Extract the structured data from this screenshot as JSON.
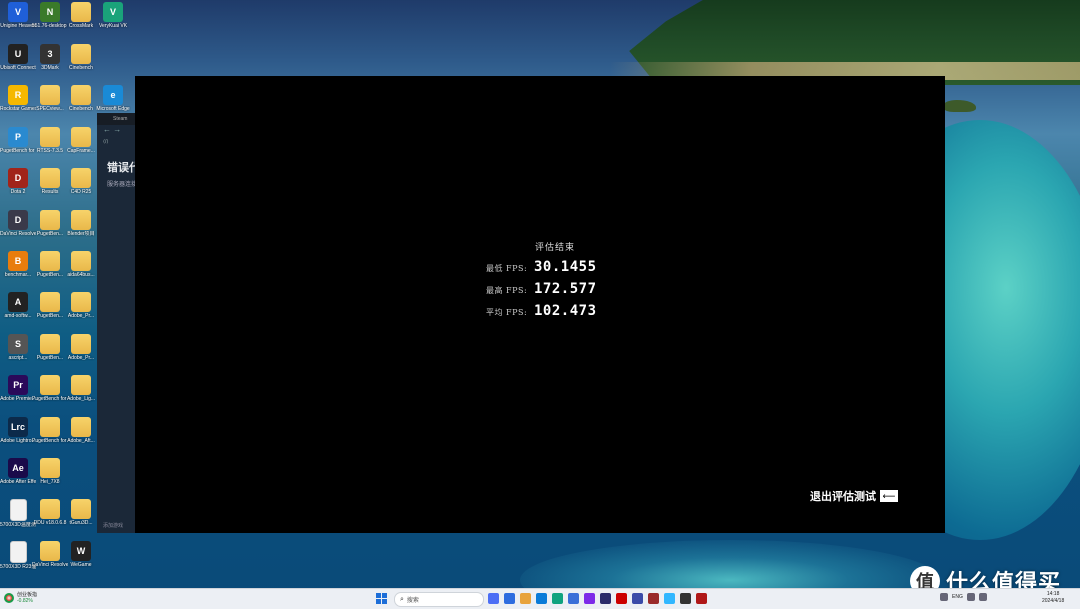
{
  "desktop_icons": [
    {
      "label": "Unigine Heaven",
      "color": "#1f5fd8",
      "glyph": "V",
      "kind": "app"
    },
    {
      "label": "551.76-desktop (1)",
      "color": "#3a7a2a",
      "glyph": "N",
      "kind": "app"
    },
    {
      "label": "CrossMark",
      "color": "",
      "glyph": "",
      "kind": "folder"
    },
    {
      "label": "VeryKuai VK",
      "color": "#1aa37a",
      "glyph": "V",
      "kind": "app"
    },
    {
      "label": "Ubisoft Connect",
      "color": "#222",
      "glyph": "U",
      "kind": "app"
    },
    {
      "label": "3DMark",
      "color": "#333",
      "glyph": "3",
      "kind": "app"
    },
    {
      "label": "Cinebench",
      "color": "",
      "glyph": "",
      "kind": "folder"
    },
    {
      "label": "Rockstar Games...",
      "color": "#f5b800",
      "glyph": "R",
      "kind": "app"
    },
    {
      "label": "SPECview...",
      "color": "",
      "glyph": "",
      "kind": "folder"
    },
    {
      "label": "Cinebench",
      "color": "",
      "glyph": "",
      "kind": "folder"
    },
    {
      "label": "Microsoft Edge",
      "color": "#1a8ad6",
      "glyph": "e",
      "kind": "app"
    },
    {
      "label": "PugetBench for Creat...",
      "color": "#2a8ad0",
      "glyph": "P",
      "kind": "app"
    },
    {
      "label": "RTSS-7.3.5",
      "color": "",
      "glyph": "",
      "kind": "folder"
    },
    {
      "label": "CapFrame...",
      "color": "",
      "glyph": "",
      "kind": "folder"
    },
    {
      "label": "Dota 2",
      "color": "#a1241a",
      "glyph": "D",
      "kind": "app"
    },
    {
      "label": "Results",
      "color": "",
      "glyph": "",
      "kind": "folder"
    },
    {
      "label": "C4D R25",
      "color": "",
      "glyph": "",
      "kind": "folder"
    },
    {
      "label": "DaVinci Resolve",
      "color": "#3a3a4a",
      "glyph": "D",
      "kind": "app"
    },
    {
      "label": "PugetBen...",
      "color": "",
      "glyph": "",
      "kind": "folder"
    },
    {
      "label": "Blender项目",
      "color": "",
      "glyph": "",
      "kind": "folder"
    },
    {
      "label": "benchmar...",
      "color": "#e87d0d",
      "glyph": "B",
      "kind": "app"
    },
    {
      "label": "PugetBen...",
      "color": "",
      "glyph": "",
      "kind": "folder"
    },
    {
      "label": "aida64bus...",
      "color": "",
      "glyph": "",
      "kind": "folder"
    },
    {
      "label": "amd-softw...",
      "color": "#222",
      "glyph": "A",
      "kind": "app"
    },
    {
      "label": "PugetBen...",
      "color": "",
      "glyph": "",
      "kind": "folder"
    },
    {
      "label": "Adobe_Pr...",
      "color": "",
      "glyph": "",
      "kind": "folder"
    },
    {
      "label": "ascript...",
      "color": "#555",
      "glyph": "S",
      "kind": "app"
    },
    {
      "label": "PugetBen...",
      "color": "",
      "glyph": "",
      "kind": "folder"
    },
    {
      "label": "Adobe_Pr...",
      "color": "",
      "glyph": "",
      "kind": "folder"
    },
    {
      "label": "Adobe Premie...",
      "color": "#2a0a5a",
      "glyph": "Pr",
      "kind": "app"
    },
    {
      "label": "PugetBench for Premi...",
      "color": "",
      "glyph": "",
      "kind": "folder"
    },
    {
      "label": "Adobe_Lig...",
      "color": "",
      "glyph": "",
      "kind": "folder"
    },
    {
      "label": "Adobe Lightro...",
      "color": "#0c2a4a",
      "glyph": "Lrc",
      "kind": "app"
    },
    {
      "label": "PugetBench for Lightr...",
      "color": "",
      "glyph": "",
      "kind": "folder"
    },
    {
      "label": "Adobe_Aft...",
      "color": "",
      "glyph": "",
      "kind": "folder"
    },
    {
      "label": "Adobe After Effects 2022",
      "color": "#1a0a4a",
      "glyph": "Ae",
      "kind": "app"
    },
    {
      "label": "Hei_7X8",
      "color": "",
      "glyph": "",
      "kind": "folder"
    },
    {
      "label": "5700X3D温度测试CSV",
      "color": "#f2f2f2",
      "glyph": "",
      "kind": "doc"
    },
    {
      "label": "DDU v18.0.6.8",
      "color": "",
      "glyph": "",
      "kind": "folder"
    },
    {
      "label": "tGuru3D...",
      "color": "",
      "glyph": "",
      "kind": "folder"
    },
    {
      "label": "5700X3D R23温度...",
      "color": "#f2f2f2",
      "glyph": "",
      "kind": "doc"
    },
    {
      "label": "DaVinci Resolve...",
      "color": "",
      "glyph": "",
      "kind": "folder"
    },
    {
      "label": "WeGame",
      "color": "#222",
      "glyph": "W",
      "kind": "app"
    }
  ],
  "steam_window": {
    "title": "Steam",
    "nav": "← →",
    "error_title": "错误代",
    "error_subtitle": "服务器连接",
    "footer": "添加游戏"
  },
  "benchmark": {
    "title": "评估结束",
    "rows": [
      {
        "key": "最低 FPS:",
        "value": "30.1455"
      },
      {
        "key": "最高 FPS:",
        "value": "172.577"
      },
      {
        "key": "平均 FPS:",
        "value": "102.473"
      }
    ],
    "exit_label": "退出评估测试",
    "exit_key": "⟵"
  },
  "taskbar": {
    "weather_title": "创业板指",
    "weather_value": "-0.82%",
    "search_placeholder": "搜索",
    "app_colors": [
      "#4c6ef5",
      "#2d6cdf",
      "#e8a33c",
      "#0a7bd8",
      "#10a37f",
      "#3a6fd8",
      "#7d2ae8",
      "#2b2b6a",
      "#cc0000",
      "#3b4ba8",
      "#9a2b2b",
      "#31b7ff",
      "#333",
      "#b01818"
    ],
    "tray_lang": "ENG",
    "clock_time": "14:18",
    "clock_date": "2024/4/18"
  },
  "watermark": {
    "logo": "值",
    "text": "什么值得买"
  }
}
